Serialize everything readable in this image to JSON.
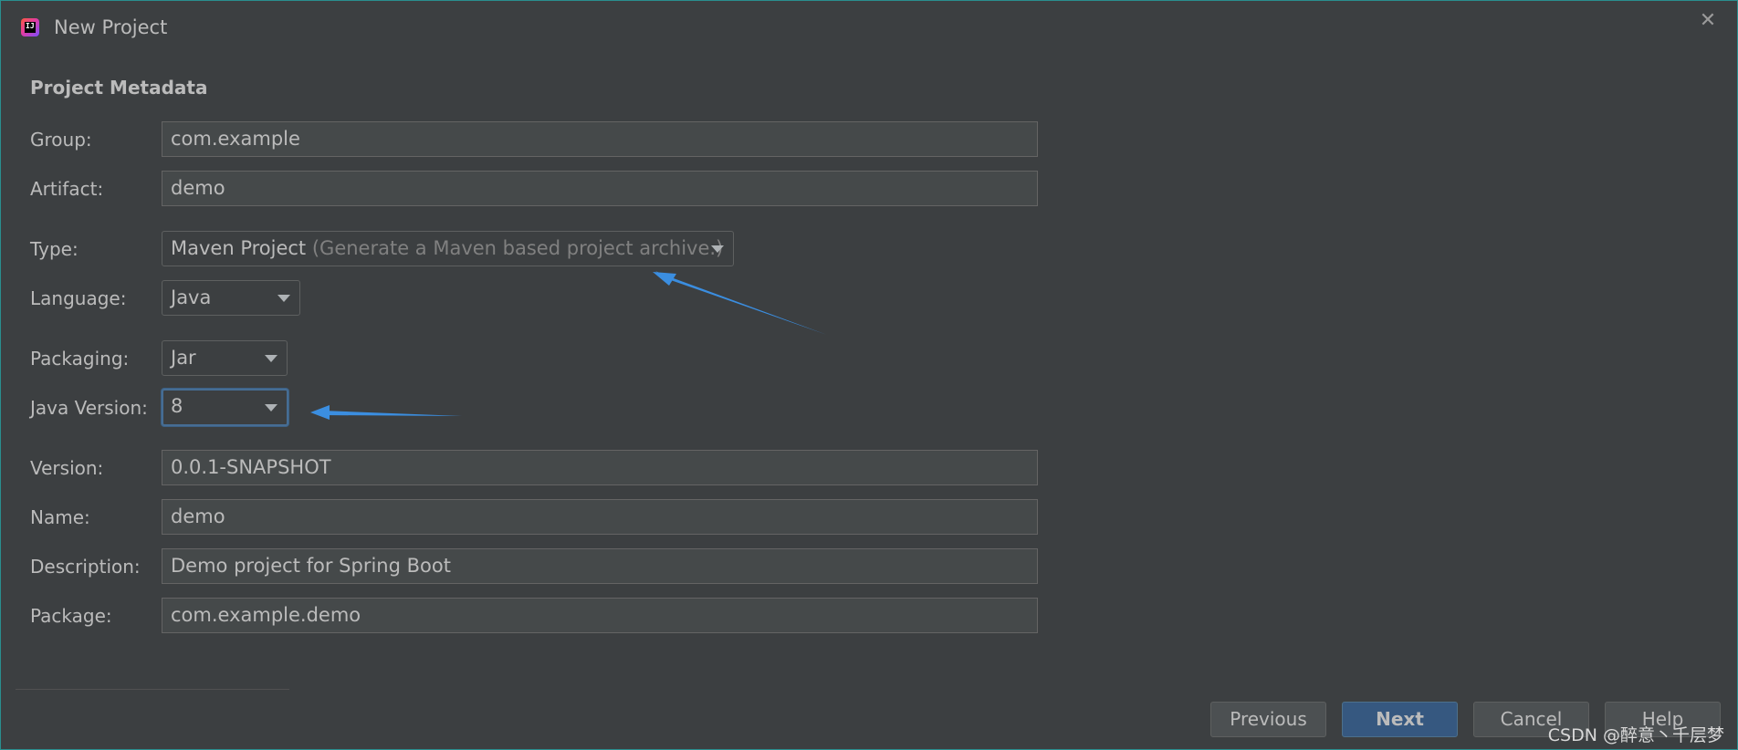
{
  "window": {
    "title": "New Project",
    "close_glyph": "✕",
    "app_icon_text": "IJ"
  },
  "section": {
    "title": "Project Metadata"
  },
  "fields": {
    "group": {
      "label": "Group:",
      "value": "com.example"
    },
    "artifact": {
      "label": "Artifact:",
      "value": "demo"
    },
    "type": {
      "label": "Type:",
      "value": "Maven Project",
      "hint": "(Generate a Maven based project archive.)"
    },
    "language": {
      "label": "Language:",
      "value": "Java"
    },
    "packaging": {
      "label": "Packaging:",
      "value": "Jar"
    },
    "java_version": {
      "label": "Java Version:",
      "value": "8"
    },
    "version": {
      "label": "Version:",
      "value": "0.0.1-SNAPSHOT"
    },
    "name": {
      "label": "Name:",
      "value": "demo"
    },
    "description": {
      "label": "Description:",
      "value": "Demo project for Spring Boot"
    },
    "package": {
      "label": "Package:",
      "value": "com.example.demo"
    }
  },
  "buttons": {
    "previous": "Previous",
    "next": "Next",
    "cancel": "Cancel",
    "help": "Help"
  },
  "watermark": "CSDN @醉意丶千层梦",
  "colors": {
    "background": "#3c3f41",
    "field_bg": "#45494a",
    "primary_button": "#365880",
    "annotation_arrow": "#3b8ee0"
  }
}
